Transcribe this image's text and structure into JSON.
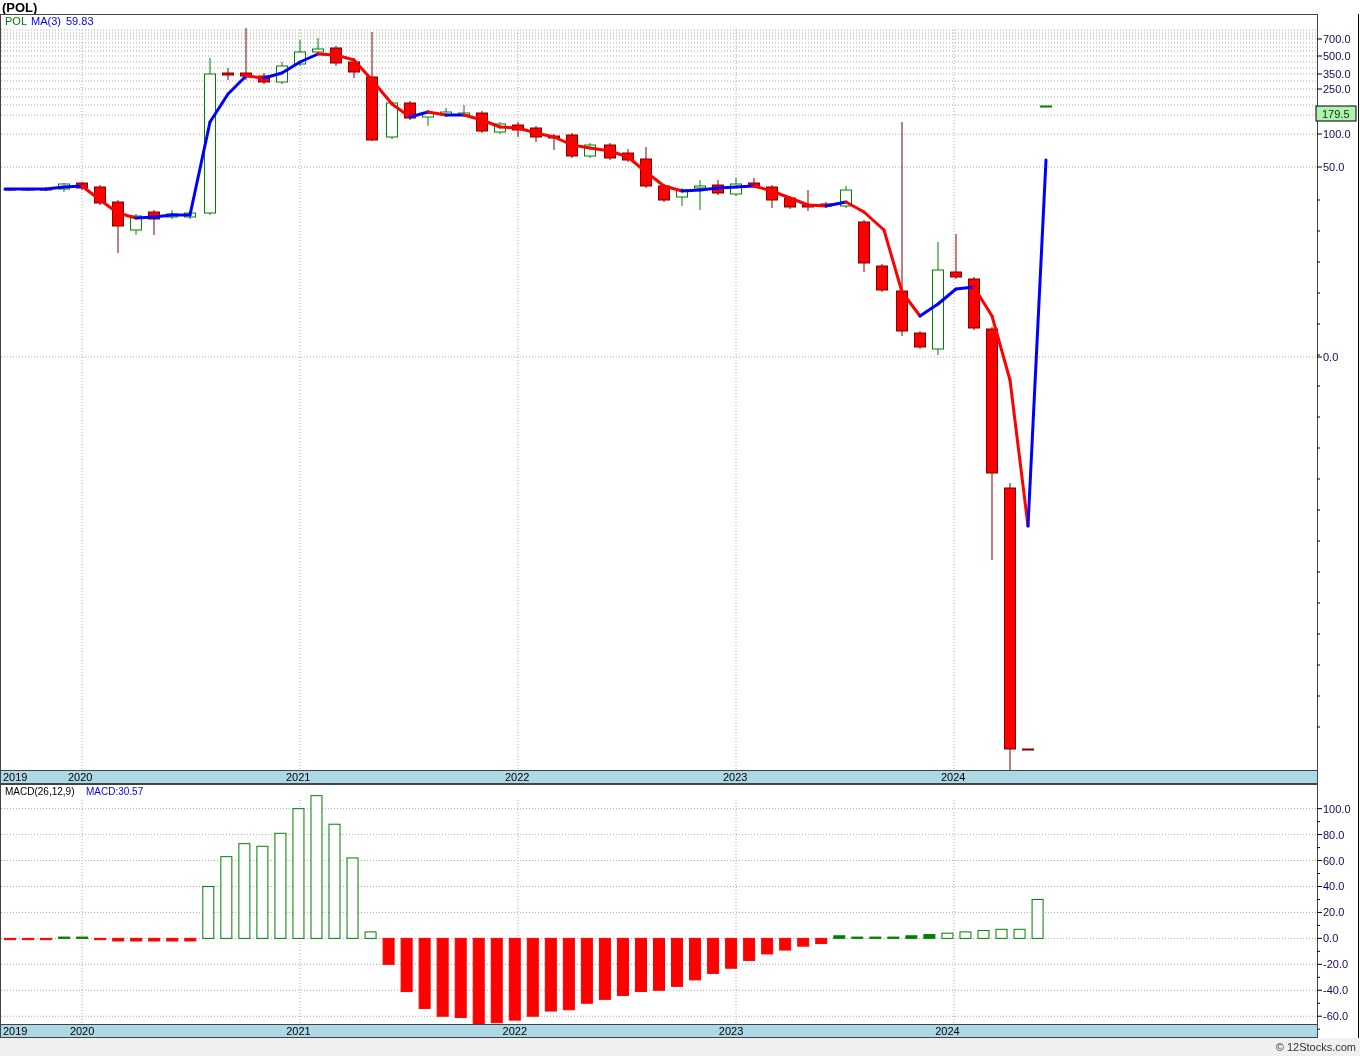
{
  "title": "(POL)",
  "price_panel": {
    "legend": [
      {
        "text": "POL",
        "color": "#008000"
      },
      {
        "text": "MA(3)",
        "color": "#0000ff"
      },
      {
        "text": "59.83",
        "color": "#0000ff"
      }
    ],
    "y_axis_labels": [
      "700.0",
      "500.0",
      "350.0",
      "250.0",
      "100.0",
      "50.0",
      "0.0"
    ],
    "last_price": "179.5",
    "x_axis_labels": [
      "2019",
      "2020",
      "2021",
      "2022",
      "2023",
      "2024"
    ]
  },
  "macd_panel": {
    "legend": [
      {
        "text": "MACD:30.57",
        "color": "#0000ff"
      }
    ],
    "chart_data": {
      "type": "bar",
      "title": "MACD(26,12,9)",
      "grid": true,
      "categories": [
        null,
        null,
        null,
        null,
        "2020",
        null,
        null,
        null,
        null,
        null,
        null,
        null,
        null,
        null,
        null,
        null,
        "2021",
        null,
        null,
        null,
        null,
        null,
        null,
        null,
        null,
        null,
        null,
        null,
        "2022",
        null,
        null,
        null,
        null,
        null,
        null,
        null,
        null,
        null,
        null,
        null,
        "2023",
        null,
        null,
        null,
        null,
        null,
        null,
        null,
        null,
        null,
        null,
        null,
        "2024",
        null,
        null,
        null,
        null,
        null,
        null,
        null,
        null,
        null,
        null,
        null,
        null,
        null,
        null,
        null,
        null,
        null,
        null,
        null,
        null
      ],
      "values": [
        -1,
        -1,
        -1,
        1,
        1,
        -1,
        -2,
        -2,
        -2,
        -2,
        -2,
        40,
        63,
        73,
        71,
        81,
        100,
        110,
        88,
        62,
        5,
        -20,
        -41,
        -54,
        -60,
        -61,
        -66,
        -65,
        -63,
        -60,
        -56,
        -55,
        -50,
        -47,
        -44,
        -41,
        -40,
        -37,
        -32,
        -27,
        -23,
        -17,
        -12,
        -9,
        -6,
        -4,
        2,
        1,
        1,
        1,
        2,
        3,
        4,
        5,
        6,
        7,
        7,
        30,
        null,
        null,
        null,
        null,
        null,
        null,
        null,
        null,
        null,
        null,
        null,
        null,
        null,
        null,
        null
      ],
      "ylim": [
        -66,
        119
      ],
      "yticks": [
        {
          "value": 100,
          "label": "100.0"
        },
        {
          "value": 80,
          "label": "80.0"
        },
        {
          "value": 60,
          "label": "60.0"
        },
        {
          "value": 40,
          "label": "40.0"
        },
        {
          "value": 20,
          "label": "20.0"
        },
        {
          "value": 0,
          "label": "0.0"
        },
        {
          "value": -20,
          "label": "-20.0"
        },
        {
          "value": -40,
          "label": "-40.0"
        },
        {
          "value": -60,
          "label": "-60.0"
        }
      ]
    },
    "x_axis_start_label": "2019"
  },
  "footer": "© 12Stocks.com"
}
